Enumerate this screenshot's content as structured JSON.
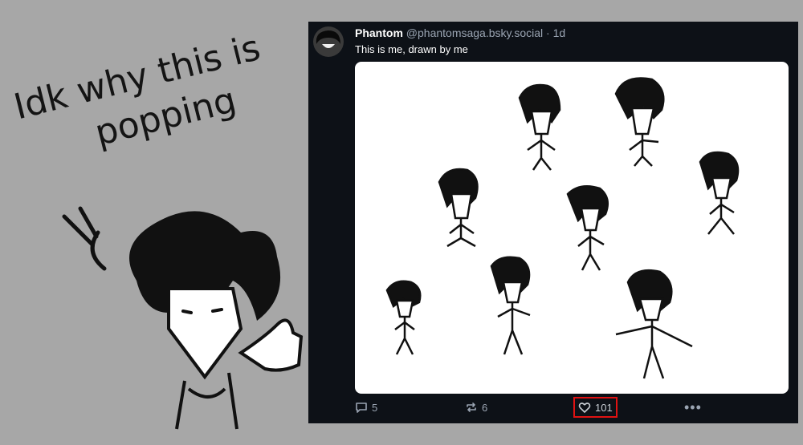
{
  "meme": {
    "caption_line1": "Idk why this is",
    "caption_line2": "popping"
  },
  "post": {
    "display_name": "Phantom",
    "handle": "@phantomsaga.bsky.social",
    "separator": "·",
    "age": "1d",
    "text": "This is me, drawn by me",
    "image_icon": "character-sketches",
    "actions": {
      "reply_count": "5",
      "repost_count": "6",
      "like_count": "101",
      "more_label": "•••"
    },
    "colors": {
      "card_bg": "#0d1117",
      "muted_text": "#9aa4b2",
      "highlight_border": "#e01212"
    }
  }
}
